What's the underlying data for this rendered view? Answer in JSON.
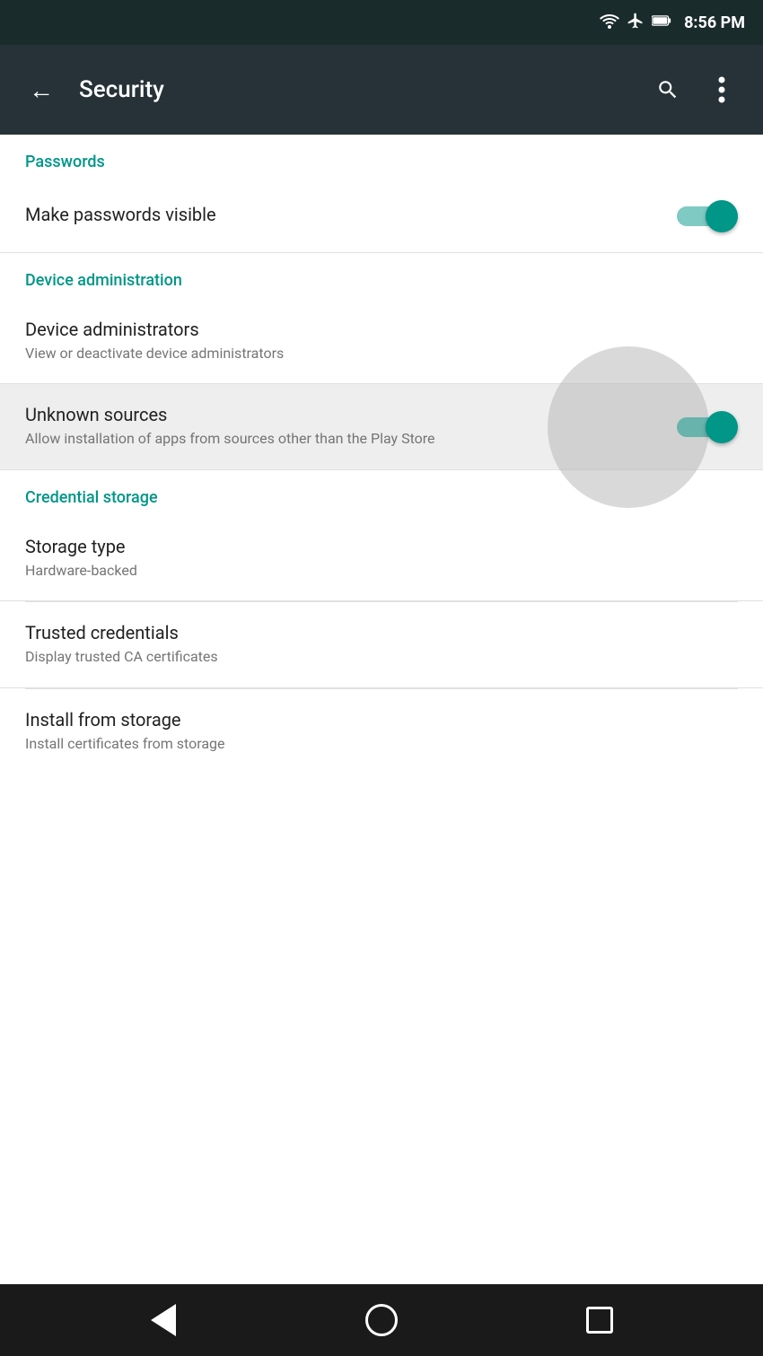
{
  "statusBar": {
    "time": "8:56 PM"
  },
  "appBar": {
    "title": "Security",
    "backLabel": "←",
    "searchLabel": "🔍",
    "moreLabel": "⋮"
  },
  "sections": [
    {
      "id": "passwords",
      "label": "Passwords",
      "items": [
        {
          "id": "make-passwords-visible",
          "title": "Make passwords visible",
          "subtitle": null,
          "hasToggle": true,
          "toggleOn": true,
          "highlighted": false
        }
      ]
    },
    {
      "id": "device-administration",
      "label": "Device administration",
      "items": [
        {
          "id": "device-administrators",
          "title": "Device administrators",
          "subtitle": "View or deactivate device administrators",
          "hasToggle": false,
          "toggleOn": false,
          "highlighted": false
        },
        {
          "id": "unknown-sources",
          "title": "Unknown sources",
          "subtitle": "Allow installation of apps from sources other than the Play Store",
          "hasToggle": true,
          "toggleOn": true,
          "highlighted": true
        }
      ]
    },
    {
      "id": "credential-storage",
      "label": "Credential storage",
      "items": [
        {
          "id": "storage-type",
          "title": "Storage type",
          "subtitle": "Hardware-backed",
          "hasToggle": false,
          "toggleOn": false,
          "highlighted": false
        },
        {
          "id": "trusted-credentials",
          "title": "Trusted credentials",
          "subtitle": "Display trusted CA certificates",
          "hasToggle": false,
          "toggleOn": false,
          "highlighted": false
        },
        {
          "id": "install-from-storage",
          "title": "Install from storage",
          "subtitle": "Install certificates from storage",
          "hasToggle": false,
          "toggleOn": false,
          "highlighted": false
        }
      ]
    }
  ],
  "navBar": {
    "back": "back",
    "home": "home",
    "recent": "recent"
  }
}
